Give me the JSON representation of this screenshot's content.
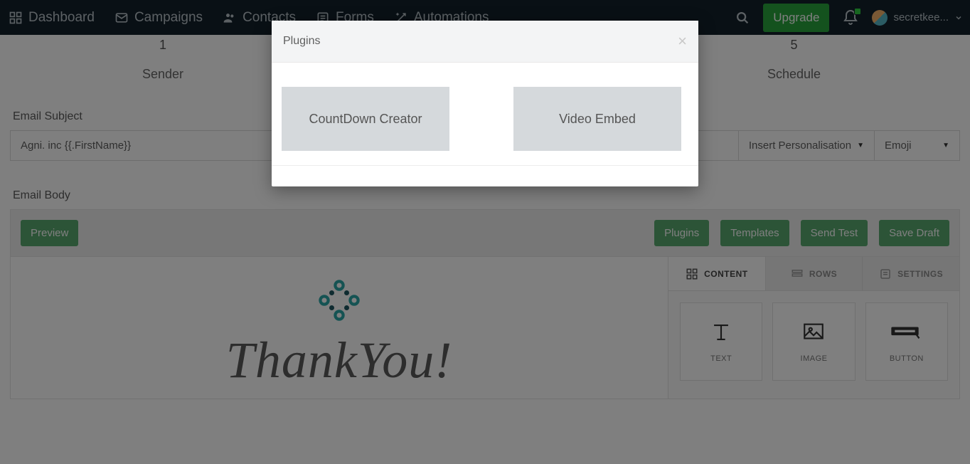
{
  "nav": {
    "items": [
      {
        "label": "Dashboard",
        "icon": "dashboard-icon"
      },
      {
        "label": "Campaigns",
        "icon": "mail-icon"
      },
      {
        "label": "Contacts",
        "icon": "people-icon"
      },
      {
        "label": "Forms",
        "icon": "forms-icon"
      },
      {
        "label": "Automations",
        "icon": "magic-icon"
      }
    ],
    "upgrade_label": "Upgrade",
    "username": "secretkee..."
  },
  "steps": {
    "first": {
      "num": "1",
      "label": "Sender"
    },
    "last": {
      "num": "5",
      "label": "Schedule"
    }
  },
  "subject": {
    "label": "Email Subject",
    "value": "Agni. inc {{.FirstName}}",
    "personalisation_label": "Insert Personalisation",
    "emoji_label": "Emoji"
  },
  "body": {
    "label": "Email Body",
    "preview": "Preview",
    "plugins": "Plugins",
    "templates": "Templates",
    "send_test": "Send Test",
    "save_draft": "Save Draft",
    "thank_text": "ThankYou!"
  },
  "panel": {
    "tabs": {
      "content": "CONTENT",
      "rows": "ROWS",
      "settings": "SETTINGS"
    },
    "cards": {
      "text": "TEXT",
      "image": "IMAGE",
      "button": "BUTTON"
    }
  },
  "modal": {
    "title": "Plugins",
    "tile1": "CountDown Creator",
    "tile2": "Video Embed"
  }
}
